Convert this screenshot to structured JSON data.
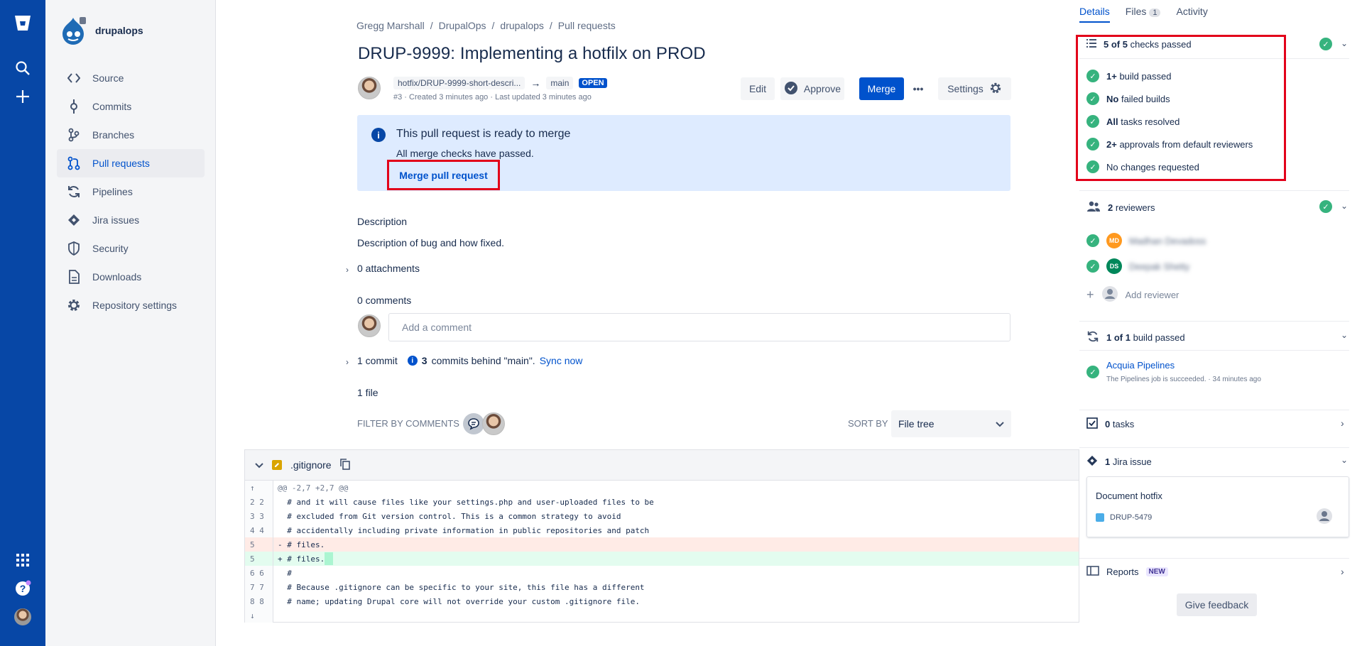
{
  "repo": {
    "name": "drupalops"
  },
  "sidebar": {
    "items": [
      {
        "label": "Source",
        "icon": "code-icon"
      },
      {
        "label": "Commits",
        "icon": "commit-icon"
      },
      {
        "label": "Branches",
        "icon": "branch-icon"
      },
      {
        "label": "Pull requests",
        "icon": "pull-request-icon",
        "active": true
      },
      {
        "label": "Pipelines",
        "icon": "pipelines-icon"
      },
      {
        "label": "Jira issues",
        "icon": "jira-icon"
      },
      {
        "label": "Security",
        "icon": "shield-icon"
      },
      {
        "label": "Downloads",
        "icon": "file-icon"
      },
      {
        "label": "Repository settings",
        "icon": "gear-icon"
      }
    ]
  },
  "breadcrumbs": [
    "Gregg Marshall",
    "DrupalOps",
    "drupalops",
    "Pull requests"
  ],
  "pr": {
    "title": "DRUP-9999: Implementing a hotfilx on PROD",
    "source_branch": "hotfix/DRUP-9999-short-descri...",
    "arrow": "→",
    "target_branch": "main",
    "status": "OPEN",
    "meta": "#3 · Created 3 minutes ago · Last updated 3 minutes ago"
  },
  "actions": {
    "edit": "Edit",
    "approve": "Approve",
    "merge": "Merge",
    "more": "•••",
    "settings": "Settings"
  },
  "banner": {
    "title": "This pull request is ready to merge",
    "subtitle": "All merge checks have passed.",
    "link": "Merge pull request"
  },
  "description": {
    "heading": "Description",
    "body": "Description of bug and how fixed."
  },
  "attachments": "0 attachments",
  "comments": {
    "heading": "0 comments",
    "placeholder": "Add a comment"
  },
  "commits": {
    "count": "1 commit",
    "behind_count": "3",
    "behind_text": "commits behind \"main\".",
    "sync": "Sync now"
  },
  "files": {
    "heading": "1 file",
    "filter_label": "FILTER BY COMMENTS",
    "sort_label": "SORT BY",
    "sort_value": "File tree"
  },
  "diff": {
    "filename": ".gitignore",
    "lines": [
      {
        "type": "hunk",
        "old": "",
        "new": "",
        "gut": "↑",
        "code": "@@ -2,7 +2,7 @@"
      },
      {
        "type": "ctx",
        "gut": "2 2",
        "code": "  # and it will cause files like your settings.php and user-uploaded files to be"
      },
      {
        "type": "ctx",
        "gut": "3 3",
        "code": "  # excluded from Git version control. This is a common strategy to avoid"
      },
      {
        "type": "ctx",
        "gut": "4 4",
        "code": "  # accidentally including private information in public repositories and patch"
      },
      {
        "type": "del",
        "gut": "5  ",
        "code": "- # files."
      },
      {
        "type": "add",
        "gut": "  5",
        "code": "+ # files."
      },
      {
        "type": "ctx",
        "gut": "6 6",
        "code": "  #"
      },
      {
        "type": "ctx",
        "gut": "7 7",
        "code": "  # Because .gitignore can be specific to your site, this file has a different"
      },
      {
        "type": "ctx",
        "gut": "8 8",
        "code": "  # name; updating Drupal core will not override your custom .gitignore file."
      },
      {
        "type": "hunk",
        "gut": "↓",
        "code": ""
      }
    ]
  },
  "right": {
    "tabs": {
      "details": "Details",
      "files": "Files",
      "files_count": "1",
      "activity": "Activity"
    },
    "checks": {
      "summary_count": "5 of 5",
      "summary_text": "checks passed",
      "items": [
        {
          "bold": "1+",
          "text": " build passed"
        },
        {
          "bold": "No",
          "text": " failed builds"
        },
        {
          "bold": "All",
          "text": " tasks resolved"
        },
        {
          "bold": "2+",
          "text": " approvals from default reviewers"
        },
        {
          "bold": "",
          "text": "No changes requested"
        }
      ]
    },
    "reviewers": {
      "count": "2",
      "label": "reviewers",
      "list": [
        {
          "initials": "MD",
          "color": "#ff991f",
          "name": "Madhan Devadoss"
        },
        {
          "initials": "DS",
          "color": "#00875a",
          "name": "Deepak Shetty"
        }
      ],
      "add": "Add reviewer"
    },
    "builds": {
      "count": "1 of 1",
      "label": "build passed",
      "name": "Acquia Pipelines",
      "detail": "The Pipelines job is succeeded.  ·  34 minutes ago"
    },
    "tasks": {
      "count": "0",
      "label": "tasks"
    },
    "jira": {
      "count": "1",
      "label": "Jira issue",
      "card_title": "Document hotfix",
      "issue_key": "DRUP-5479"
    },
    "reports": {
      "label": "Reports",
      "badge": "NEW"
    },
    "feedback": "Give feedback"
  }
}
